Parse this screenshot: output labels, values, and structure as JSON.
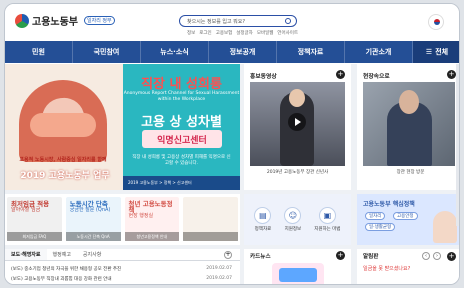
{
  "app": {
    "title": "고용노동부",
    "subtitle": "일자리 정부"
  },
  "search": {
    "placeholder": "찾으시는 정보를 입고 뭐요?"
  },
  "utility_links": [
    "정보",
    "로그인",
    "고용보험",
    "설정글자",
    "모바일웹",
    "언어사이트"
  ],
  "nav": {
    "items": [
      "민원",
      "국민참여",
      "뉴스·소식",
      "정보공개",
      "정책자료",
      "기관소개"
    ],
    "all_label": "전체"
  },
  "banner": {
    "left": {
      "caption": "포용적 노동시장, 사람중심 일자리를 함께",
      "year_text": "2019 고용노동부 업무"
    },
    "right": {
      "title": "직장 내 성희롱",
      "english": "Anonymous Report Channel for Sexual Harassment within the Workplace",
      "main": "고용 상 성차별",
      "box": "익명신고센터",
      "small": "직장 내 성희롱 및 고용상 성차별 피해를 익명으로 신고할 수 있습니다.",
      "footer": "2019 고용노동부 > 정책 > 신고센터"
    }
  },
  "video": {
    "title": "홍보동영상",
    "caption": "2019년 고용노동부 장관 신년사"
  },
  "photo": {
    "title": "현장속으로",
    "caption": "장관 현장 방문"
  },
  "quick_tiles": [
    {
      "big": "최저임금 적용",
      "text": "알아야할 임금",
      "bar": "최저임금 FAQ"
    },
    {
      "big": "노동시간 단축",
      "text": "궁금한 질문 (QnA)",
      "bar": "노동시간 단축 QnA"
    },
    {
      "big": "청년 고용노동정책",
      "text": "현장 행정실",
      "bar": "청년고용정책 안내"
    },
    {
      "big": "",
      "text": "",
      "bar": ""
    }
  ],
  "shortcuts": [
    {
      "icon": "document",
      "label": "정책자료"
    },
    {
      "icon": "person",
      "label": "지원정보"
    },
    {
      "icon": "book",
      "label": "지원하는 마법"
    }
  ],
  "policy": {
    "title": "고용노동부 핵심정책",
    "items": [
      "일자리",
      "고용안정",
      "일·생활균형"
    ]
  },
  "news": {
    "tabs": [
      "보도·해명자료",
      "행정예고",
      "공지사항"
    ],
    "items": [
      {
        "text": "(보도) 중소기업 청년의 자극을 위한 채용형 공모 전환 추진",
        "date": "2019.02.07"
      },
      {
        "text": "(보도) 고용노동부 직장내 괴롭힘 대응 강화 관련 안내",
        "date": "2019.02.07"
      }
    ]
  },
  "card": {
    "title": "카드뉴스"
  },
  "alarm": {
    "title": "알림판",
    "text": "일금을 못 받으셨나요?"
  },
  "colors": {
    "nav": "#244f96",
    "nav_all": "#1a3d7a",
    "banner_teal": "#2ab7c0",
    "banner_red": "#ff4f4f",
    "tile_red": "#c23a31"
  }
}
